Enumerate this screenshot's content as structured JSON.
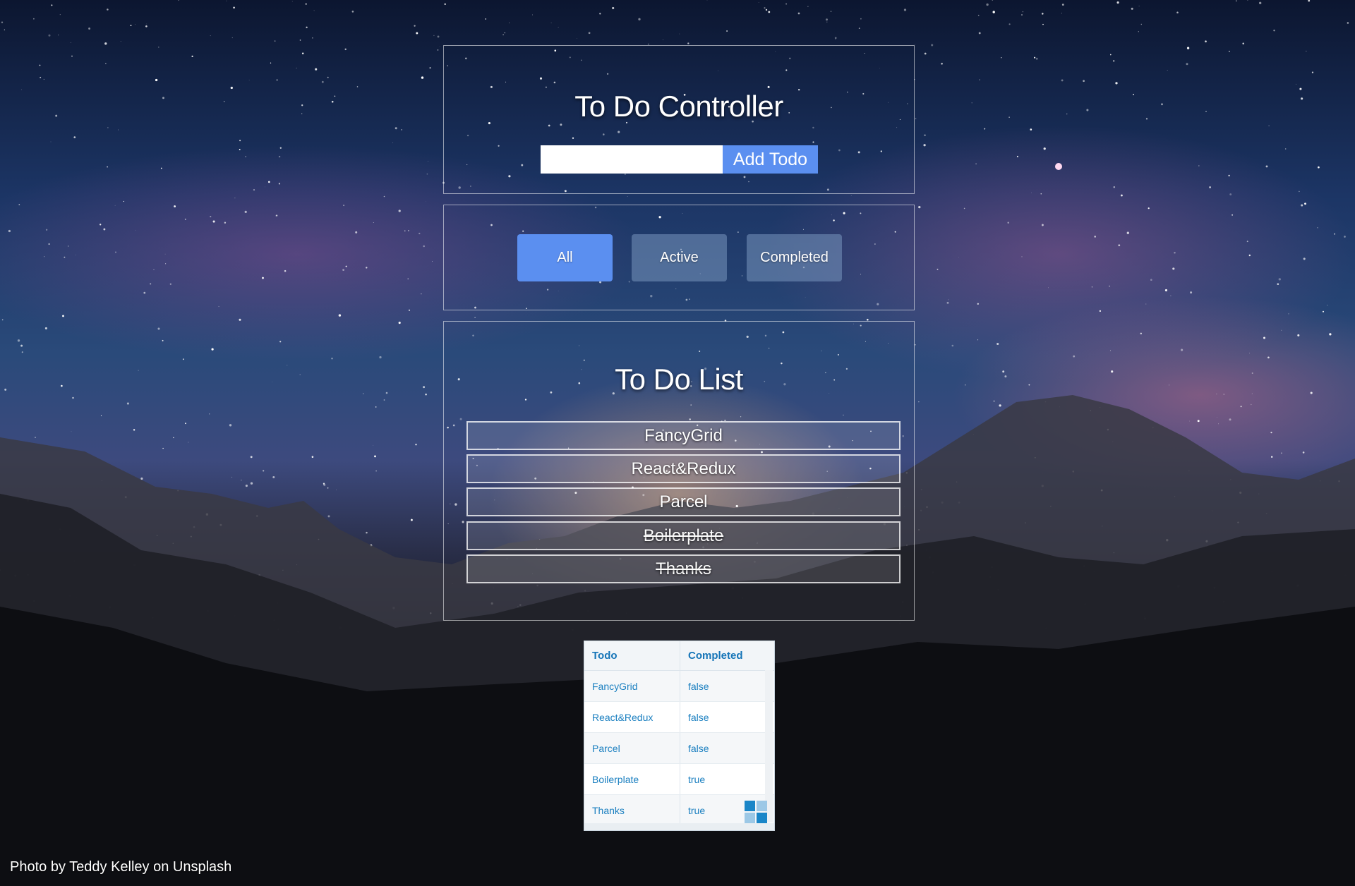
{
  "controller": {
    "title": "To Do Controller",
    "input_value": "",
    "input_placeholder": "",
    "add_label": "Add Todo"
  },
  "filters": {
    "all": "All",
    "active": "Active",
    "completed": "Completed",
    "selected": "All"
  },
  "list": {
    "title": "To Do List",
    "items": [
      {
        "text": "FancyGrid",
        "completed": false
      },
      {
        "text": "React&Redux",
        "completed": false
      },
      {
        "text": "Parcel",
        "completed": false
      },
      {
        "text": "Boilerplate",
        "completed": true
      },
      {
        "text": "Thanks",
        "completed": true
      }
    ]
  },
  "grid": {
    "columns": [
      "Todo",
      "Completed"
    ],
    "rows": [
      [
        "FancyGrid",
        "false"
      ],
      [
        "React&Redux",
        "false"
      ],
      [
        "Parcel",
        "false"
      ],
      [
        "Boilerplate",
        "true"
      ],
      [
        "Thanks",
        "true"
      ]
    ]
  },
  "credit": "Photo by Teddy Kelley on Unsplash",
  "colors": {
    "accent": "#5b8ff0",
    "grid_text": "#1a7fc0"
  }
}
